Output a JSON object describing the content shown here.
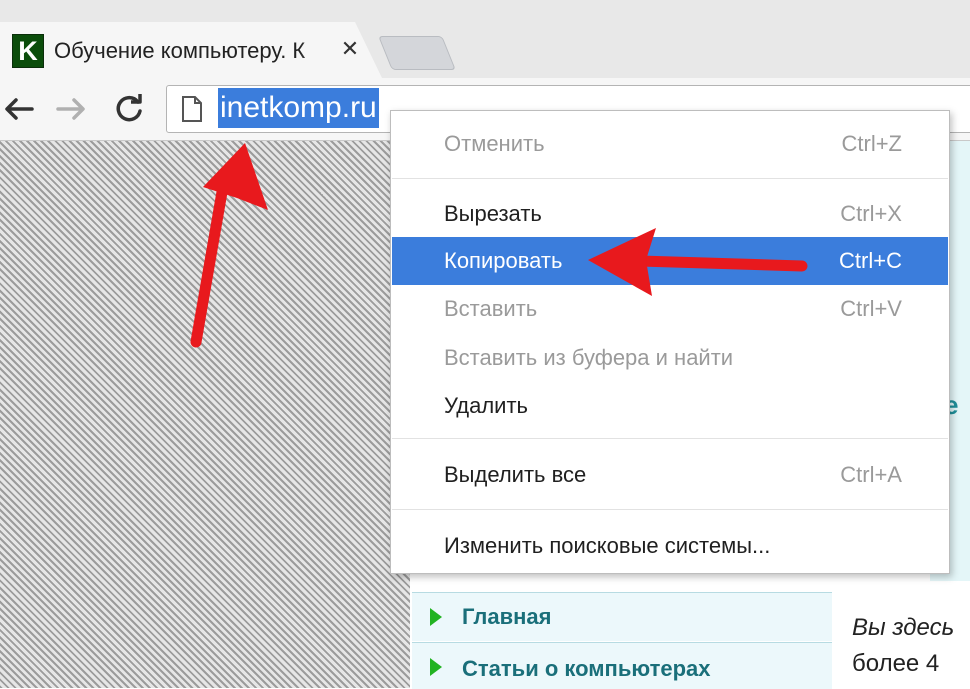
{
  "browser": {
    "tab": {
      "favicon_letter": "K",
      "title": "Обучение компьютеру. К",
      "close_glyph": "✕"
    },
    "address_bar": {
      "url": "inetkomp.ru"
    }
  },
  "context_menu": {
    "items": [
      {
        "label": "Отменить",
        "shortcut": "Ctrl+Z",
        "enabled": false
      },
      {
        "label": "Вырезать",
        "shortcut": "Ctrl+X",
        "enabled": true
      },
      {
        "label": "Копировать",
        "shortcut": "Ctrl+C",
        "enabled": true,
        "highlighted": true
      },
      {
        "label": "Вставить",
        "shortcut": "Ctrl+V",
        "enabled": false
      },
      {
        "label": "Вставить из буфера и найти",
        "shortcut": "",
        "enabled": false
      },
      {
        "label": "Удалить",
        "shortcut": "",
        "enabled": true
      },
      {
        "label": "Выделить все",
        "shortcut": "Ctrl+A",
        "enabled": true
      },
      {
        "label": "Изменить поисковые системы...",
        "shortcut": "",
        "enabled": true
      }
    ]
  },
  "page": {
    "nav_items": [
      {
        "label": "Главная"
      },
      {
        "label": "Статьи о компьютерах"
      }
    ],
    "side_texts": [
      "Вы здесь",
      "более 4"
    ],
    "edge_glyph": "е"
  },
  "colors": {
    "selection_blue": "#3b7ddc",
    "annotation_red": "#e8191d",
    "nav_arrow_green": "#22b322"
  }
}
